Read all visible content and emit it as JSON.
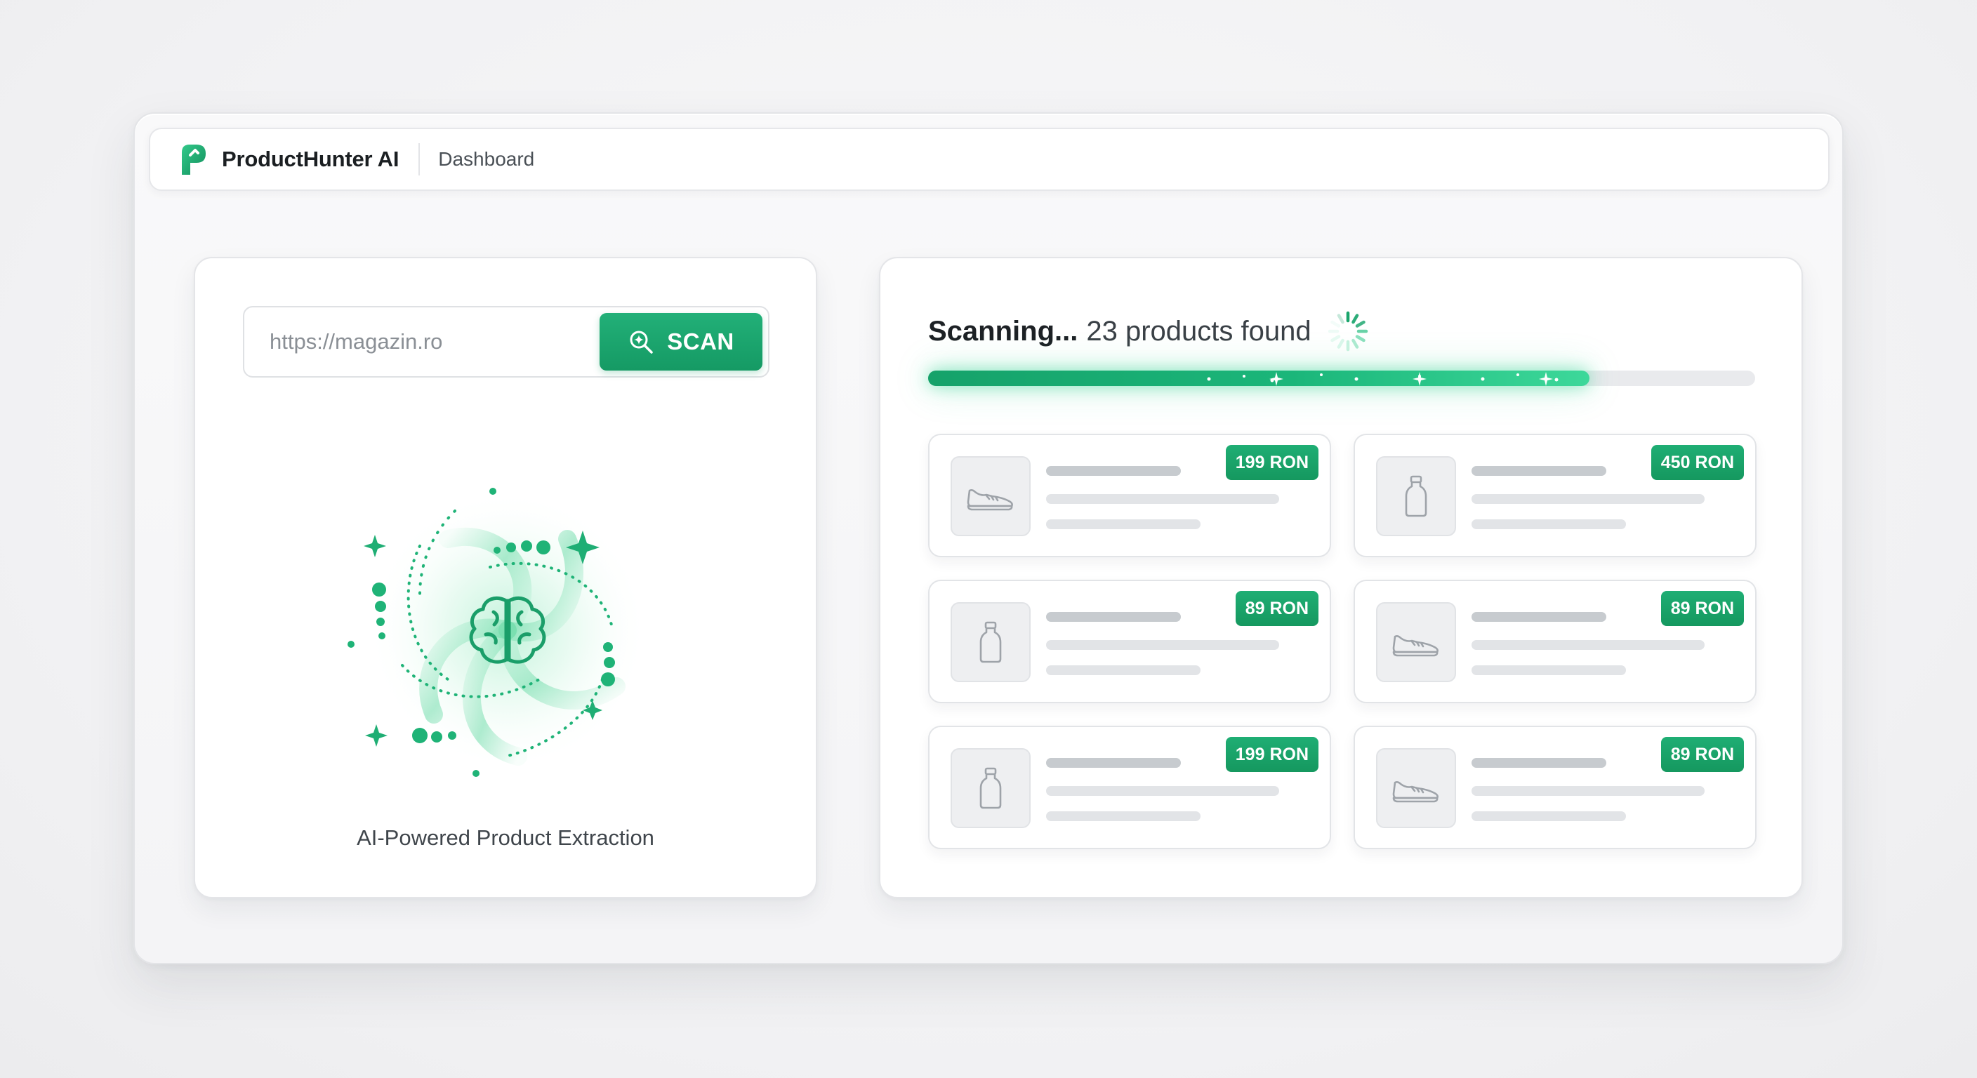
{
  "header": {
    "app_name": "ProductHunter AI",
    "breadcrumb": "Dashboard",
    "logo_icon": "producthunter-logo-icon"
  },
  "search": {
    "placeholder": "https://magazin.ro",
    "value": "",
    "scan_label": "SCAN",
    "scan_icon": "search-sparkle-icon"
  },
  "ai_visual": {
    "caption": "AI-Powered Product Extraction",
    "icon": "brain-icon"
  },
  "scan_status": {
    "state": "Scanning...",
    "count_text": "23 products found",
    "progress": 0.8,
    "spinner_icon": "loading-spinner-icon"
  },
  "products": [
    {
      "price": "199 RON",
      "icon": "sneaker-icon"
    },
    {
      "price": "450 RON",
      "icon": "bottle-icon"
    },
    {
      "price": "89 RON",
      "icon": "bottle-icon"
    },
    {
      "price": "89 RON",
      "icon": "sneaker-icon"
    },
    {
      "price": "199 RON",
      "icon": "bottle-icon"
    },
    {
      "price": "89 RON",
      "icon": "sneaker-icon"
    }
  ],
  "colors": {
    "accent": "#1aa56c",
    "accent_glow": "#3dd89a",
    "skeleton_dark": "#c7cbcf",
    "skeleton_light": "#e2e4e7"
  }
}
